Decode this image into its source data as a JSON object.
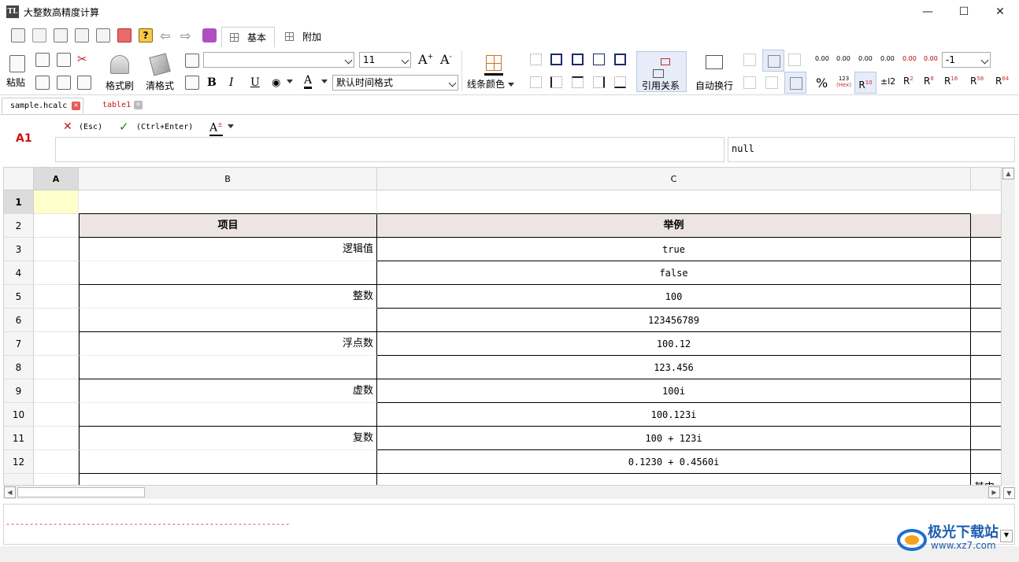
{
  "window": {
    "title": "大整数高精度计算",
    "icon_text": "TL"
  },
  "top_tabs": [
    {
      "label": "基本"
    },
    {
      "label": "附加"
    }
  ],
  "ribbon": {
    "paste": "粘贴",
    "format_painter": "格式刷",
    "clear_format": "清格式",
    "font_size": "11",
    "font_name": "",
    "bold": "B",
    "italic": "I",
    "underline": "U",
    "font_color_glyph": "A",
    "grow_font": "A",
    "shrink_font": "A",
    "date_format": "默认时间格式",
    "line_color": "线条颜色",
    "reference": "引用关系",
    "auto_wrap": "自动换行",
    "decimal_select": "-1",
    "percent": "%",
    "hex_top": "123",
    "hex_bottom": "(Hex)",
    "r10": "R",
    "r10_sup": "10",
    "r2": "R",
    "r2_sup": "2",
    "r8": "R",
    "r8_sup": "8",
    "r16": "R",
    "r16_sup": "16",
    "r58": "R",
    "r58_sup": "58",
    "r64": "R",
    "r64_sup": "64",
    "round_label": "±l2",
    "dec0": "0.00",
    "dec1": "0.00",
    "dec2": "0.00",
    "dec3": "0.00",
    "dec4": "0.00",
    "dec5": "0.00"
  },
  "file_tabs": [
    {
      "label": "sample.hcalc",
      "color": "#000000"
    },
    {
      "label": "table1",
      "color": "#c01818"
    }
  ],
  "formula_bar": {
    "cell_ref": "A1",
    "cancel_hint": "(Esc)",
    "confirm_hint": "(Ctrl+Enter)",
    "font_glyph": "A",
    "value": "null",
    "formula": ""
  },
  "sheet": {
    "columns": [
      "A",
      "B",
      "C"
    ],
    "rows": [
      "1",
      "2",
      "3",
      "4",
      "5",
      "6",
      "7",
      "8",
      "9",
      "10",
      "11",
      "12"
    ],
    "header_row": {
      "b": "项目",
      "c": "举例"
    },
    "data": [
      {
        "b": "逻辑值",
        "c": "true"
      },
      {
        "b": "",
        "c": "false"
      },
      {
        "b": "整数",
        "c": "100"
      },
      {
        "b": "",
        "c": "123456789"
      },
      {
        "b": "浮点数",
        "c": "100.12"
      },
      {
        "b": "",
        "c": "123.456"
      },
      {
        "b": "虚数",
        "c": "100i"
      },
      {
        "b": "",
        "c": "100.123i"
      },
      {
        "b": "复数",
        "c": "100 + 123i"
      },
      {
        "b": "",
        "c": "0.1230 + 0.4560i"
      }
    ],
    "overflow_text": "其中"
  },
  "output": {
    "dash_line": "------------------------------------------------------------"
  },
  "watermark": {
    "cn": "极光下载站",
    "url": "www.xz7.com"
  },
  "colors": {
    "header_fill": "#ede4e4",
    "selected_cell": "#ffffcc",
    "accent_red": "#d01010"
  }
}
